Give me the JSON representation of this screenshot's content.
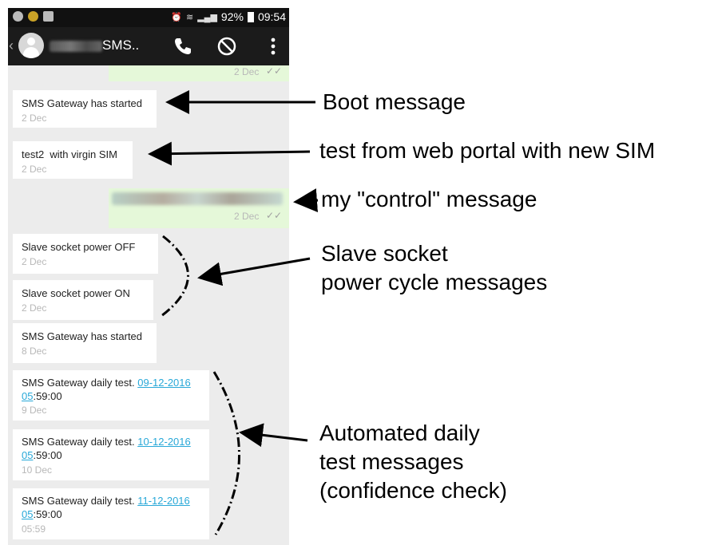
{
  "status_bar": {
    "battery": "92%",
    "time": "09:54"
  },
  "app_bar": {
    "title": "SMS.."
  },
  "messages": [
    {
      "direction": "out",
      "text": "",
      "date": "2 Dec"
    },
    {
      "direction": "in",
      "text": "SMS Gateway has started",
      "date": "2 Dec"
    },
    {
      "direction": "in",
      "text": "test2  with virgin SIM",
      "date": "2 Dec"
    },
    {
      "direction": "out",
      "text": "",
      "date": "2 Dec"
    },
    {
      "direction": "in",
      "text": "Slave socket power OFF",
      "date": "2 Dec"
    },
    {
      "direction": "in",
      "text": "Slave socket power ON",
      "date": "2 Dec"
    },
    {
      "direction": "in",
      "text": "SMS Gateway has started",
      "date": "8 Dec"
    },
    {
      "direction": "in",
      "text_prefix": "SMS Gateway daily test. ",
      "link_a": "09-12-2016",
      "link_b": "05",
      "text_suffix": ":59:00",
      "date": "9 Dec"
    },
    {
      "direction": "in",
      "text_prefix": "SMS Gateway daily test. ",
      "link_a": "10-12-2016",
      "link_b": "05",
      "text_suffix": ":59:00",
      "date": "10 Dec"
    },
    {
      "direction": "in",
      "text_prefix": "SMS Gateway daily test. ",
      "link_a": "11-12-2016",
      "link_b": "05",
      "text_suffix": ":59:00",
      "date": "05:59"
    }
  ],
  "annotations": [
    {
      "lines": [
        "Boot message"
      ]
    },
    {
      "lines": [
        "test from web portal with new SIM"
      ]
    },
    {
      "lines": [
        "my \"control\" message"
      ]
    },
    {
      "lines": [
        "Slave socket",
        "power cycle messages"
      ]
    },
    {
      "lines": [
        "Automated daily",
        "test messages",
        "(confidence check)"
      ]
    }
  ]
}
